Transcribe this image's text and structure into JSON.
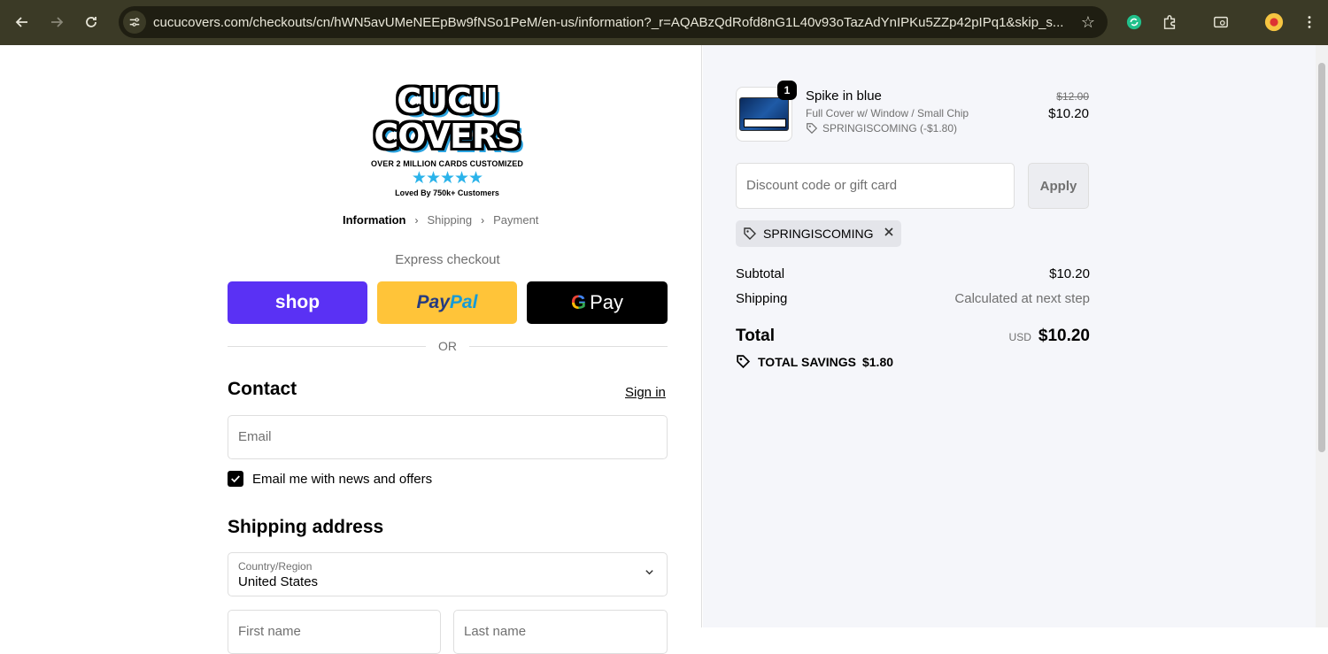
{
  "browser": {
    "url": "cucucovers.com/checkouts/cn/hWN5avUMeNEEpBw9fNSo1PeM/en-us/information?_r=AQABzQdRofd8nG1L40v93oTazAdYnIPKu5ZZp42pIPq1&skip_s..."
  },
  "logo": {
    "line1": "CUCU",
    "line2": "COVERS",
    "tagline": "OVER 2 MILLION CARDS CUSTOMIZED",
    "stars": "★★★★★",
    "loved": "Loved By 750k+ Customers"
  },
  "breadcrumb": {
    "items": [
      "Information",
      "Shipping",
      "Payment"
    ],
    "separator": "›"
  },
  "express": {
    "title": "Express checkout",
    "shop_label": "shop",
    "paypal_part1": "Pay",
    "paypal_part2": "Pal",
    "gpay_g": "G",
    "gpay_label": "Pay",
    "or": "OR"
  },
  "contact": {
    "title": "Contact",
    "signin": "Sign in",
    "email_placeholder": "Email",
    "newsletter_label": "Email me with news and offers",
    "newsletter_checked": true
  },
  "shipping": {
    "title": "Shipping address",
    "country_label": "Country/Region",
    "country_value": "United States",
    "first_placeholder": "First name",
    "last_placeholder": "Last name"
  },
  "order": {
    "quantity": "1",
    "item_name": "Spike in blue",
    "item_variant": "Full Cover w/ Window / Small Chip",
    "item_discount": "SPRINGISCOMING (-$1.80)",
    "old_price": "$12.00",
    "price": "$10.20",
    "discount_placeholder": "Discount code or gift card",
    "apply_label": "Apply",
    "applied_code": "SPRINGISCOMING",
    "subtotal_label": "Subtotal",
    "subtotal_value": "$10.20",
    "shipping_label": "Shipping",
    "shipping_value": "Calculated at next step",
    "total_label": "Total",
    "currency": "USD",
    "total_value": "$10.20",
    "savings_label": "TOTAL SAVINGS",
    "savings_value": "$1.80"
  },
  "colors": {
    "shop": "#5a31f4",
    "paypal": "#ffc439",
    "gpay": "#000000",
    "logo_accent": "#2aa3e0"
  }
}
